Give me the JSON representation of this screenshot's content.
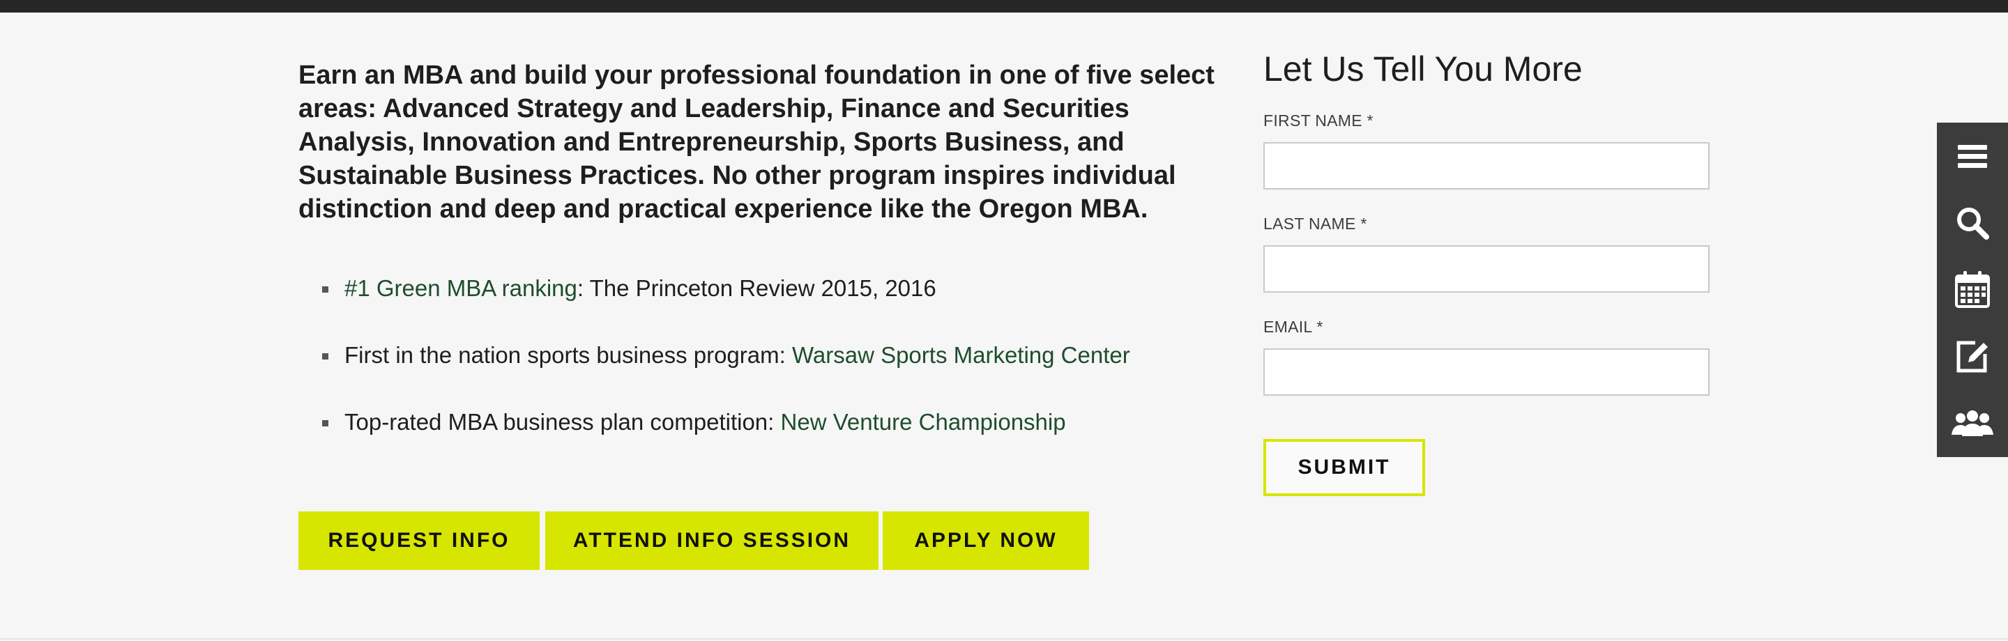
{
  "intro": {
    "text": "Earn an MBA and build your professional foundation in one of five select areas: Advanced Strategy and Leadership, Finance and Securities Analysis, Innovation and Entrepreneurship, Sports Business, and Sustainable Business Practices. No other program inspires individual distinction and deep and practical experience like the Oregon MBA."
  },
  "highlights": [
    {
      "link": "#1 Green MBA ranking",
      "text": ": The Princeton Review 2015, 2016"
    },
    {
      "text": "First in the nation sports business program: ",
      "link": "Warsaw Sports Marketing Center"
    },
    {
      "text": "Top-rated MBA business plan competition: ",
      "link": "New Venture Championship"
    }
  ],
  "cta": {
    "request_info": "REQUEST INFO",
    "attend_session": "ATTEND INFO SESSION",
    "apply_now": "APPLY NOW"
  },
  "form": {
    "title": "Let Us Tell You More",
    "first_name_label": "FIRST NAME *",
    "first_name_value": "",
    "last_name_label": "LAST NAME *",
    "last_name_value": "",
    "email_label": "EMAIL *",
    "email_value": "",
    "submit_label": "SUBMIT"
  },
  "sidebar": {
    "icons": [
      "menu-icon",
      "search-icon",
      "calendar-icon",
      "edit-icon",
      "people-icon"
    ]
  },
  "colors": {
    "accent": "#d7e600",
    "link": "#1f4d2c",
    "topbar": "#262626",
    "sidebar": "#3c3c3c",
    "background": "#f6f6f6"
  }
}
